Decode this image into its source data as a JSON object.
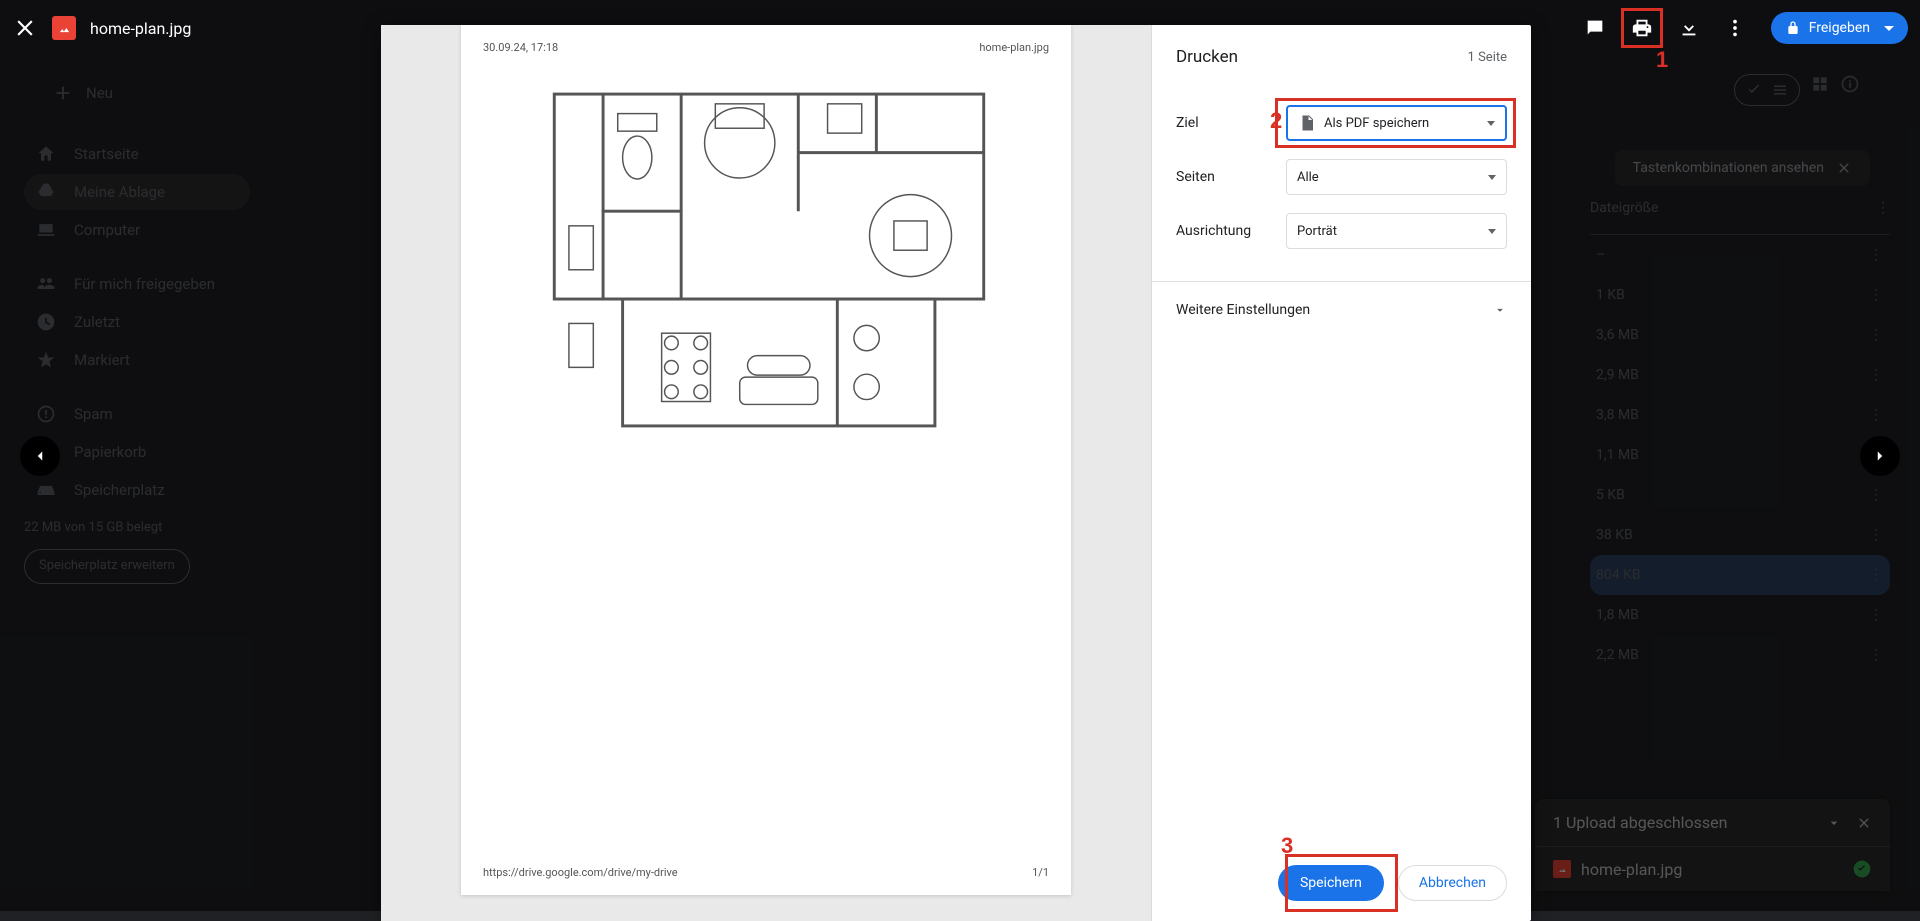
{
  "viewer": {
    "file_name": "home-plan.jpg",
    "share_label": "Freigeben"
  },
  "sidebar": {
    "new_label": "Neu",
    "items": [
      {
        "label": "Startseite"
      },
      {
        "label": "Meine Ablage"
      },
      {
        "label": "Computer"
      },
      {
        "label": "Für mich freigegeben"
      },
      {
        "label": "Zuletzt"
      },
      {
        "label": "Markiert"
      },
      {
        "label": "Spam"
      },
      {
        "label": "Papierkorb"
      },
      {
        "label": "Speicherplatz"
      }
    ],
    "storage_used": "22 MB von 15 GB belegt",
    "storage_cta": "Speicherplatz erweitern"
  },
  "shortcut_banner": "Tastenkombinationen ansehen",
  "file_list": {
    "header_size": "Dateigröße",
    "rows": [
      {
        "size": "–"
      },
      {
        "size": "1 KB"
      },
      {
        "size": "3,6 MB"
      },
      {
        "size": "2,9 MB"
      },
      {
        "size": "3,8 MB"
      },
      {
        "size": "1,1 MB"
      },
      {
        "size": "5 KB"
      },
      {
        "size": "38 KB"
      },
      {
        "size": "804 KB",
        "selected": true
      },
      {
        "size": "1,8 MB"
      },
      {
        "size": "2,2 MB"
      }
    ]
  },
  "upload_toast": {
    "title": "1 Upload abgeschlossen",
    "file": "home-plan.jpg"
  },
  "print": {
    "title": "Drucken",
    "page_count": "1 Seite",
    "settings": {
      "destination": {
        "label": "Ziel",
        "value": "Als PDF speichern"
      },
      "pages": {
        "label": "Seiten",
        "value": "Alle"
      },
      "orientation": {
        "label": "Ausrichtung",
        "value": "Porträt"
      }
    },
    "more_label": "Weitere Einstellungen",
    "save_label": "Speichern",
    "cancel_label": "Abbrechen",
    "preview": {
      "timestamp": "30.09.24, 17:18",
      "filename": "home-plan.jpg",
      "url": "https://drive.google.com/drive/my-drive",
      "pager": "1/1"
    }
  },
  "annotations": {
    "a1": "1",
    "a2": "2",
    "a3": "3"
  }
}
